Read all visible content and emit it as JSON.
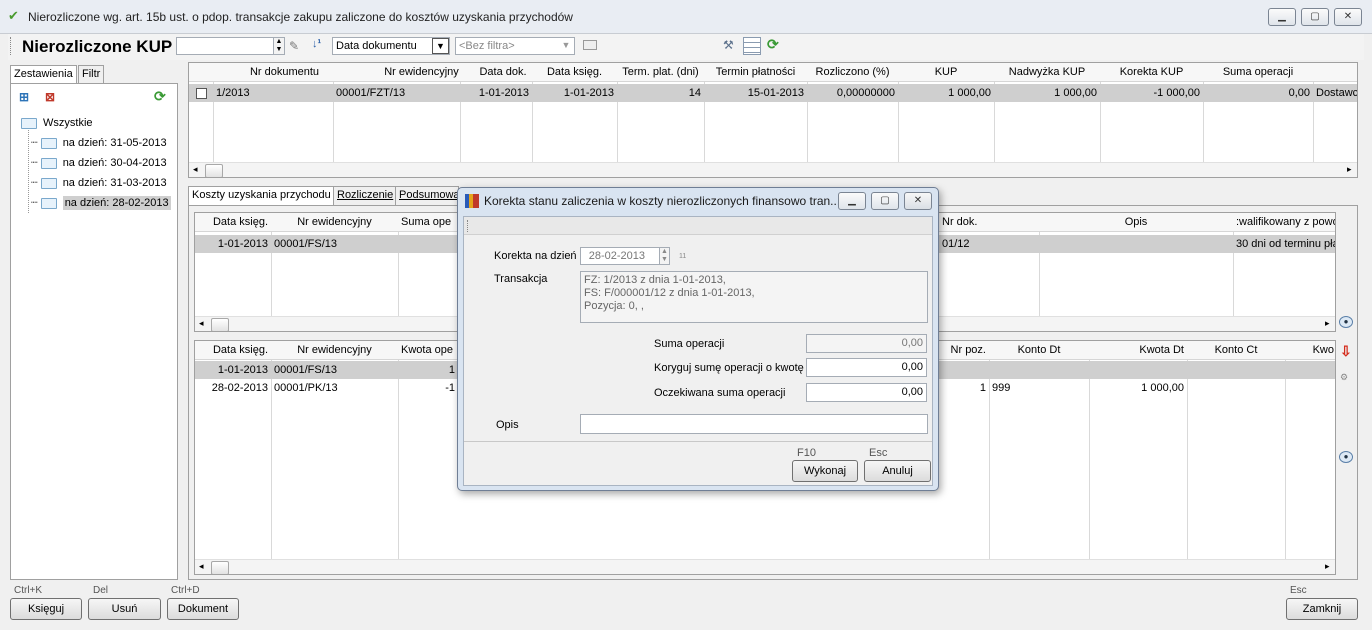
{
  "window": {
    "title": "Nierozliczone wg. art. 15b ust. o pdop. transakcje zakupu zaliczone do kosztów uzyskania przychodów"
  },
  "toolbar": {
    "heading": "Nierozliczone KUP",
    "search_value": "",
    "sort_label": "Data dokumentu",
    "filter_placeholder": "<Bez filtra>"
  },
  "left_panel": {
    "tabs": [
      "Zestawienia",
      "Filtr"
    ],
    "tree": {
      "root": "Wszystkie",
      "items": [
        "na dzień: 31-05-2013",
        "na dzień: 30-04-2013",
        "na dzień: 31-03-2013",
        "na dzień: 28-02-2013"
      ]
    }
  },
  "top_grid": {
    "columns": [
      "Nr dokumentu",
      "Nr ewidencyjny",
      "Data dok.",
      "Data księg.",
      "Term. plat. (dni)",
      "Termin płatności",
      "Rozliczono (%)",
      "KUP",
      "Nadwyżka KUP",
      "Korekta KUP",
      "Suma operacji",
      ""
    ],
    "rows": [
      [
        "1/2013",
        "00001/FZT/13",
        "1-01-2013",
        "1-01-2013",
        "14",
        "15-01-2013",
        "0,00000000",
        "1 000,00",
        "1 000,00",
        "-1 000,00",
        "0,00",
        "Dostawca"
      ]
    ]
  },
  "mid_tabs": [
    "Koszty uzyskania przychodu",
    "Rozliczenie",
    "Podsumowa"
  ],
  "grid2": {
    "columns_left": [
      "Data księg.",
      "Nr ewidencyjny",
      "Suma ope"
    ],
    "columns_right": [
      "Nr dok.",
      "Opis",
      ":walifikowany z powo"
    ],
    "row_left": [
      "1-01-2013",
      "00001/FS/13"
    ],
    "row_right": [
      "01/12",
      "",
      "30 dni od terminu pła"
    ]
  },
  "grid3": {
    "columns_left": [
      "Data księg.",
      "Nr ewidencyjny",
      "Kwota ope"
    ],
    "columns_right": [
      "Nr poz.",
      "Konto Dt",
      "Kwota Dt",
      "Konto Ct",
      "Kwo"
    ],
    "rows_left": [
      [
        "1-01-2013",
        "00001/FS/13",
        "1"
      ],
      [
        "28-02-2013",
        "00001/PK/13",
        "-1"
      ]
    ],
    "rows_right": [
      [
        "",
        "",
        "",
        "",
        ""
      ],
      [
        "1",
        "999",
        "1 000,00",
        "",
        ""
      ]
    ]
  },
  "bottom": {
    "keys": {
      "ksieguj": "Ctrl+K",
      "usun": "Del",
      "dokument": "Ctrl+D",
      "zamknij": "Esc"
    },
    "labels": {
      "ksieguj": "Księguj",
      "usun": "Usuń",
      "dokument": "Dokument",
      "zamknij": "Zamknij"
    }
  },
  "dialog": {
    "title": "Korekta stanu zaliczenia w koszty nierozliczonych finansowo tran...",
    "korekta_label": "Korekta na dzień",
    "korekta_date": "28-02-2013",
    "korekta_suffix": "11",
    "transakcja_label": "Transakcja",
    "transakcja_lines": [
      "FZ: 1/2013 z dnia  1-01-2013,",
      "FS: F/000001/12 z dnia  1-01-2013,",
      "Pozycja: 0, ,"
    ],
    "suma_label": "Suma operacji",
    "suma_value": "0,00",
    "koryguj_label": "Koryguj sumę operacji o kwotę",
    "koryguj_value": "0,00",
    "oczekiwana_label": "Oczekiwana suma operacji",
    "oczekiwana_value": "0,00",
    "opis_label": "Opis",
    "opis_value": "",
    "wykonaj_key": "F10",
    "wykonaj_label": "Wykonaj",
    "anuluj_key": "Esc",
    "anuluj_label": "Anuluj"
  }
}
